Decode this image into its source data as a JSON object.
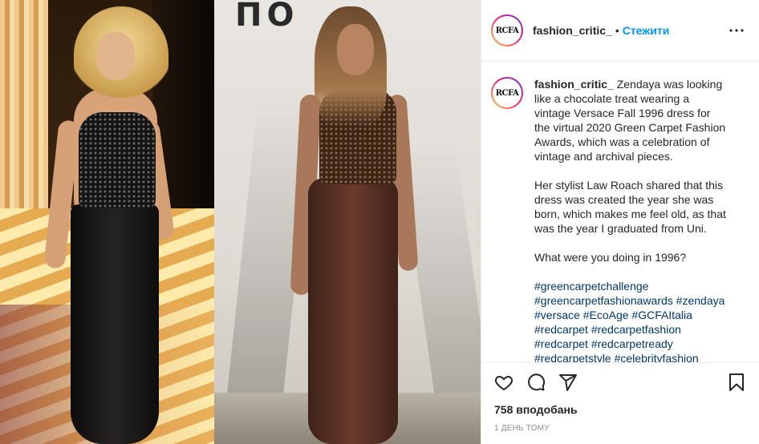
{
  "media": {
    "wall_text": "ПО"
  },
  "header": {
    "avatar_text": "RCFA",
    "username": "fashion_critic_",
    "separator": "•",
    "follow_label": "Стежити",
    "more_icon": "more-horizontal-icon"
  },
  "caption": {
    "avatar_text": "RCFA",
    "username": "fashion_critic_",
    "paragraphs": [
      "Zendaya was looking like a chocolate treat wearing a vintage Versace Fall 1996 dress for the virtual 2020 Green Carpet Fashion Awards, which was a celebration of vintage and archival pieces.",
      "Her stylist Law Roach shared that this dress was created the year she was born, which makes me feel old, as that was the year I graduated from Uni.",
      "What were you doing in 1996?"
    ],
    "hashtags": [
      "#greencarpetchallenge",
      "#greencarpetfashionawards #zendaya",
      "#versace #EcoAge #GCFAItalia",
      "#redcarpet #redcarpetfashion",
      "#redcarpet #redcarpetready",
      "#redcarpetstyle #celebrityfashion"
    ]
  },
  "actions": {
    "like_icon": "heart-icon",
    "comment_icon": "comment-icon",
    "share_icon": "share-icon",
    "save_icon": "bookmark-icon",
    "likes_text": "758 вподобань",
    "time_text": "1 день тому"
  }
}
